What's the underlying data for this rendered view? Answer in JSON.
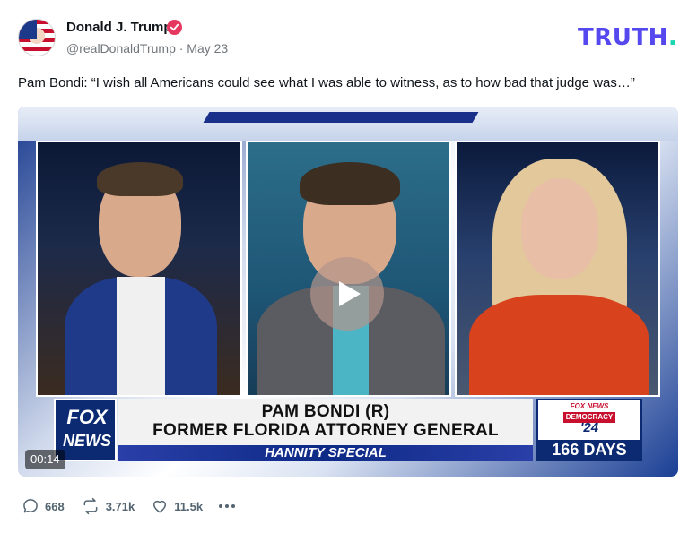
{
  "author": {
    "name": "Donald J. Trump",
    "handle": "@realDonaldTrump",
    "date": "May 23",
    "handle_date": "@realDonaldTrump · May 23",
    "verified_color": "#e6375f"
  },
  "brand": {
    "logo_main": "TRUTH",
    "logo_dot": ".",
    "primary_color": "#5448ee",
    "accent_color": "#18d6b0"
  },
  "post": {
    "text": "Pam Bondi: “I wish all Americans could see what I was able to witness, as to how bad that judge was…”"
  },
  "video": {
    "timestamp": "00:14",
    "lower_third": {
      "network_line1": "FOX",
      "network_line2": "NEWS",
      "name": "PAM BONDI (R)",
      "title": "FORMER FLORIDA ATTORNEY GENERAL",
      "show": "HANNITY SPECIAL"
    },
    "countdown": {
      "network": "FOX NEWS",
      "label": "DEMOCRACY",
      "year": "'24",
      "days": "166 DAYS"
    }
  },
  "actions": {
    "replies": "668",
    "retruths": "3.71k",
    "likes": "11.5k"
  }
}
